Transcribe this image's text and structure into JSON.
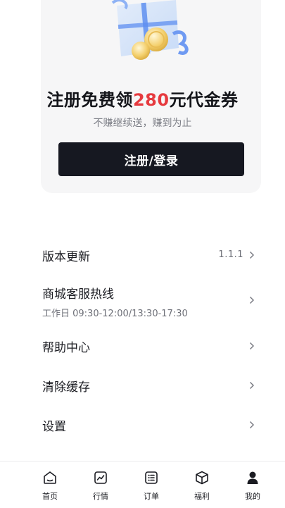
{
  "promo": {
    "title_before": "注册免费领",
    "title_amount": "280",
    "title_after": "元代金券",
    "subtitle": "不赚继续送，赚到为止",
    "button_label": "注册/登录"
  },
  "menu": {
    "version": {
      "label": "版本更新",
      "value": "1.1.1"
    },
    "hotline": {
      "label": "商城客服热线",
      "hours": "工作日 09:30-12:00/13:30-17:30"
    },
    "help": {
      "label": "帮助中心"
    },
    "clear_cache": {
      "label": "清除缓存"
    },
    "settings": {
      "label": "设置"
    }
  },
  "tabbar": {
    "tabs": [
      {
        "label": "首页",
        "icon": "home-icon"
      },
      {
        "label": "行情",
        "icon": "market-chart-icon"
      },
      {
        "label": "订单",
        "icon": "order-list-icon"
      },
      {
        "label": "福利",
        "icon": "gift-box-icon"
      },
      {
        "label": "我的",
        "icon": "user-icon"
      }
    ],
    "active": "我的"
  },
  "colors": {
    "accent": "#e63a3f",
    "button_bg": "#161821",
    "card_bg": "#f6f6f7"
  }
}
